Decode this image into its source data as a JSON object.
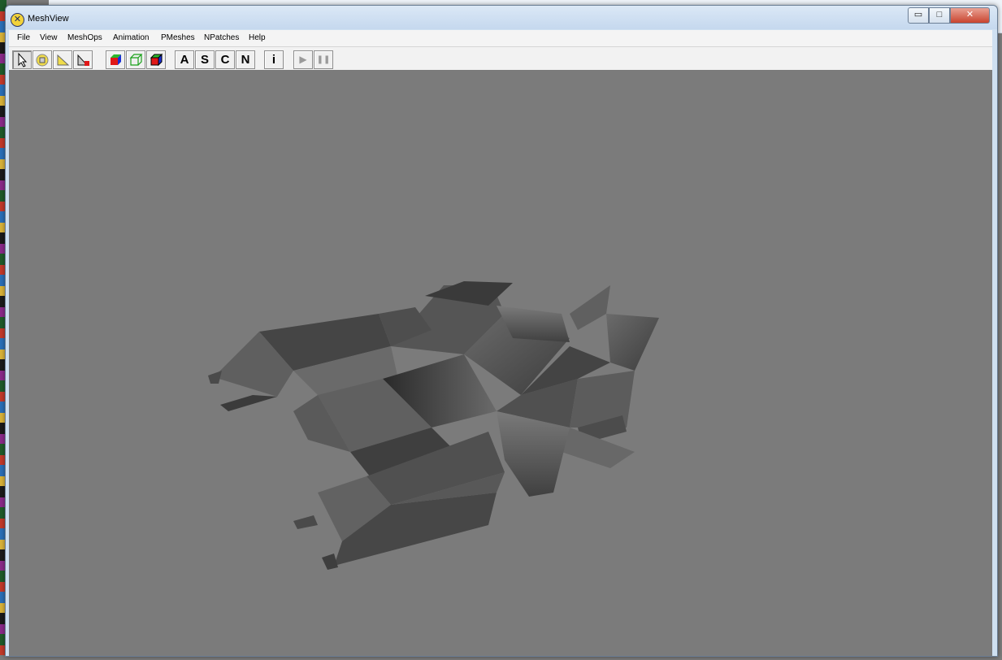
{
  "window": {
    "title": "MeshView",
    "controls": {
      "minimize": "▭",
      "maximize": "□",
      "close": "✕"
    }
  },
  "menu": [
    "File",
    "View",
    "MeshOps",
    "Animation",
    "PMeshes",
    "NPatches",
    "Help"
  ],
  "toolbar": {
    "letters": {
      "a": "A",
      "s": "S",
      "c": "C",
      "n": "N",
      "info": "i"
    },
    "play": "▶",
    "pause": "❚❚"
  },
  "viewport": {
    "background": "#7b7b7b",
    "model": "gray-shaded-3d-mesh"
  }
}
